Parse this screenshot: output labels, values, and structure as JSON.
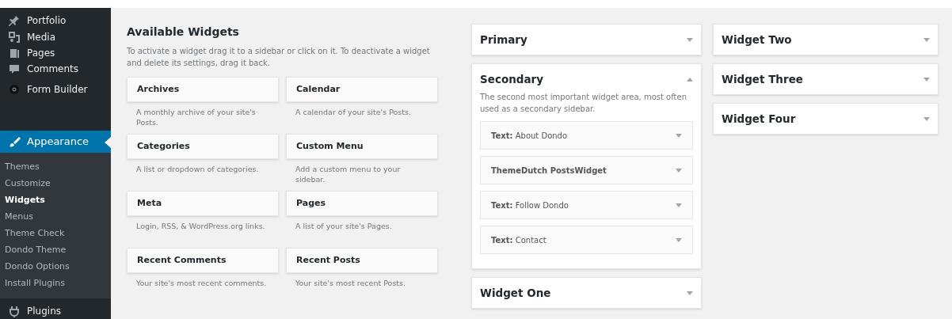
{
  "admin_menu": {
    "items": [
      {
        "label": "Portfolio",
        "selected": false
      },
      {
        "label": "Media",
        "selected": false
      },
      {
        "label": "Pages",
        "selected": false
      },
      {
        "label": "Comments",
        "selected": false
      },
      {
        "label": "Form Builder",
        "selected": false
      },
      {
        "label": "Appearance",
        "selected": true,
        "submenu": [
          {
            "label": "Themes",
            "selected": false
          },
          {
            "label": "Customize",
            "selected": false
          },
          {
            "label": "Widgets",
            "selected": true
          },
          {
            "label": "Menus",
            "selected": false
          },
          {
            "label": "Theme Check",
            "selected": false
          },
          {
            "label": "Dondo Theme",
            "selected": false
          },
          {
            "label": "Dondo Options",
            "selected": false
          },
          {
            "label": "Install Plugins",
            "selected": false
          }
        ]
      },
      {
        "label": "Plugins",
        "selected": false
      }
    ]
  },
  "available_widgets": {
    "title": "Available Widgets",
    "description": "To activate a widget drag it to a sidebar or click on it. To deactivate a widget and delete its settings, drag it back.",
    "widgets": [
      {
        "name": "Archives",
        "description": "A monthly archive of your site's Posts."
      },
      {
        "name": "Calendar",
        "description": "A calendar of your site's Posts."
      },
      {
        "name": "Categories",
        "description": "A list or dropdown of categories."
      },
      {
        "name": "Custom Menu",
        "description": "Add a custom menu to your sidebar."
      },
      {
        "name": "Meta",
        "description": "Login, RSS, & WordPress.org links."
      },
      {
        "name": "Pages",
        "description": "A list of your site's Pages."
      },
      {
        "name": "Recent Comments",
        "description": "Your site's most recent comments."
      },
      {
        "name": "Recent Posts",
        "description": "Your site's most recent Posts."
      }
    ]
  },
  "widget_areas": [
    [
      {
        "title": "Primary",
        "expanded": false
      },
      {
        "title": "Secondary",
        "expanded": true,
        "description": "The second most important widget area, most often used as a secondary sidebar.",
        "widgets": [
          "**Text:** About Dondo",
          "**ThemeDutch PostsWidget**",
          "**Text:** Follow Dondo",
          "**Text:** Contact"
        ]
      },
      {
        "title": "Widget One",
        "expanded": false
      }
    ],
    [
      {
        "title": "Widget Two",
        "expanded": false
      },
      {
        "title": "Widget Three",
        "expanded": false
      },
      {
        "title": "Widget Four",
        "expanded": false
      }
    ]
  ]
}
